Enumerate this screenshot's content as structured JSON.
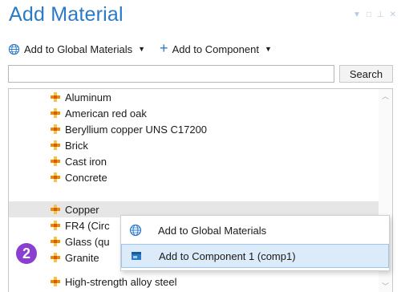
{
  "window": {
    "title": "Add Material",
    "controls": [
      "▼",
      "□",
      "⊥",
      "✕"
    ]
  },
  "toolbar": {
    "global_label": "Add to Global Materials",
    "component_label": "Add to Component"
  },
  "search": {
    "value": "",
    "placeholder": "",
    "button_label": "Search"
  },
  "materials": [
    {
      "label": "Aluminum",
      "selected": false
    },
    {
      "label": "American red oak",
      "selected": false
    },
    {
      "label": "Beryllium copper UNS C17200",
      "selected": false
    },
    {
      "label": "Brick",
      "selected": false
    },
    {
      "label": "Cast iron",
      "selected": false
    },
    {
      "label": "Concrete",
      "selected": false
    },
    {
      "label": "Copper",
      "selected": true
    },
    {
      "label": "FR4 (Circ",
      "selected": false
    },
    {
      "label": "Glass (qu",
      "selected": false
    },
    {
      "label": "Granite",
      "selected": false
    },
    {
      "label": "High-strength alloy steel",
      "selected": false
    }
  ],
  "context_menu": {
    "items": [
      {
        "label": "Add to Global Materials",
        "icon": "globe-icon",
        "highlighted": false
      },
      {
        "label": "Add to Component 1 (comp1)",
        "icon": "component-icon",
        "highlighted": true
      }
    ]
  },
  "step_badge": "2",
  "colors": {
    "title": "#2b7ac7",
    "accent": "#2b7ac7",
    "selection": "#e6e6e6",
    "menu_highlight": "#dcebf9",
    "badge": "#8a3fd0",
    "material_icon": "#f08a00"
  }
}
